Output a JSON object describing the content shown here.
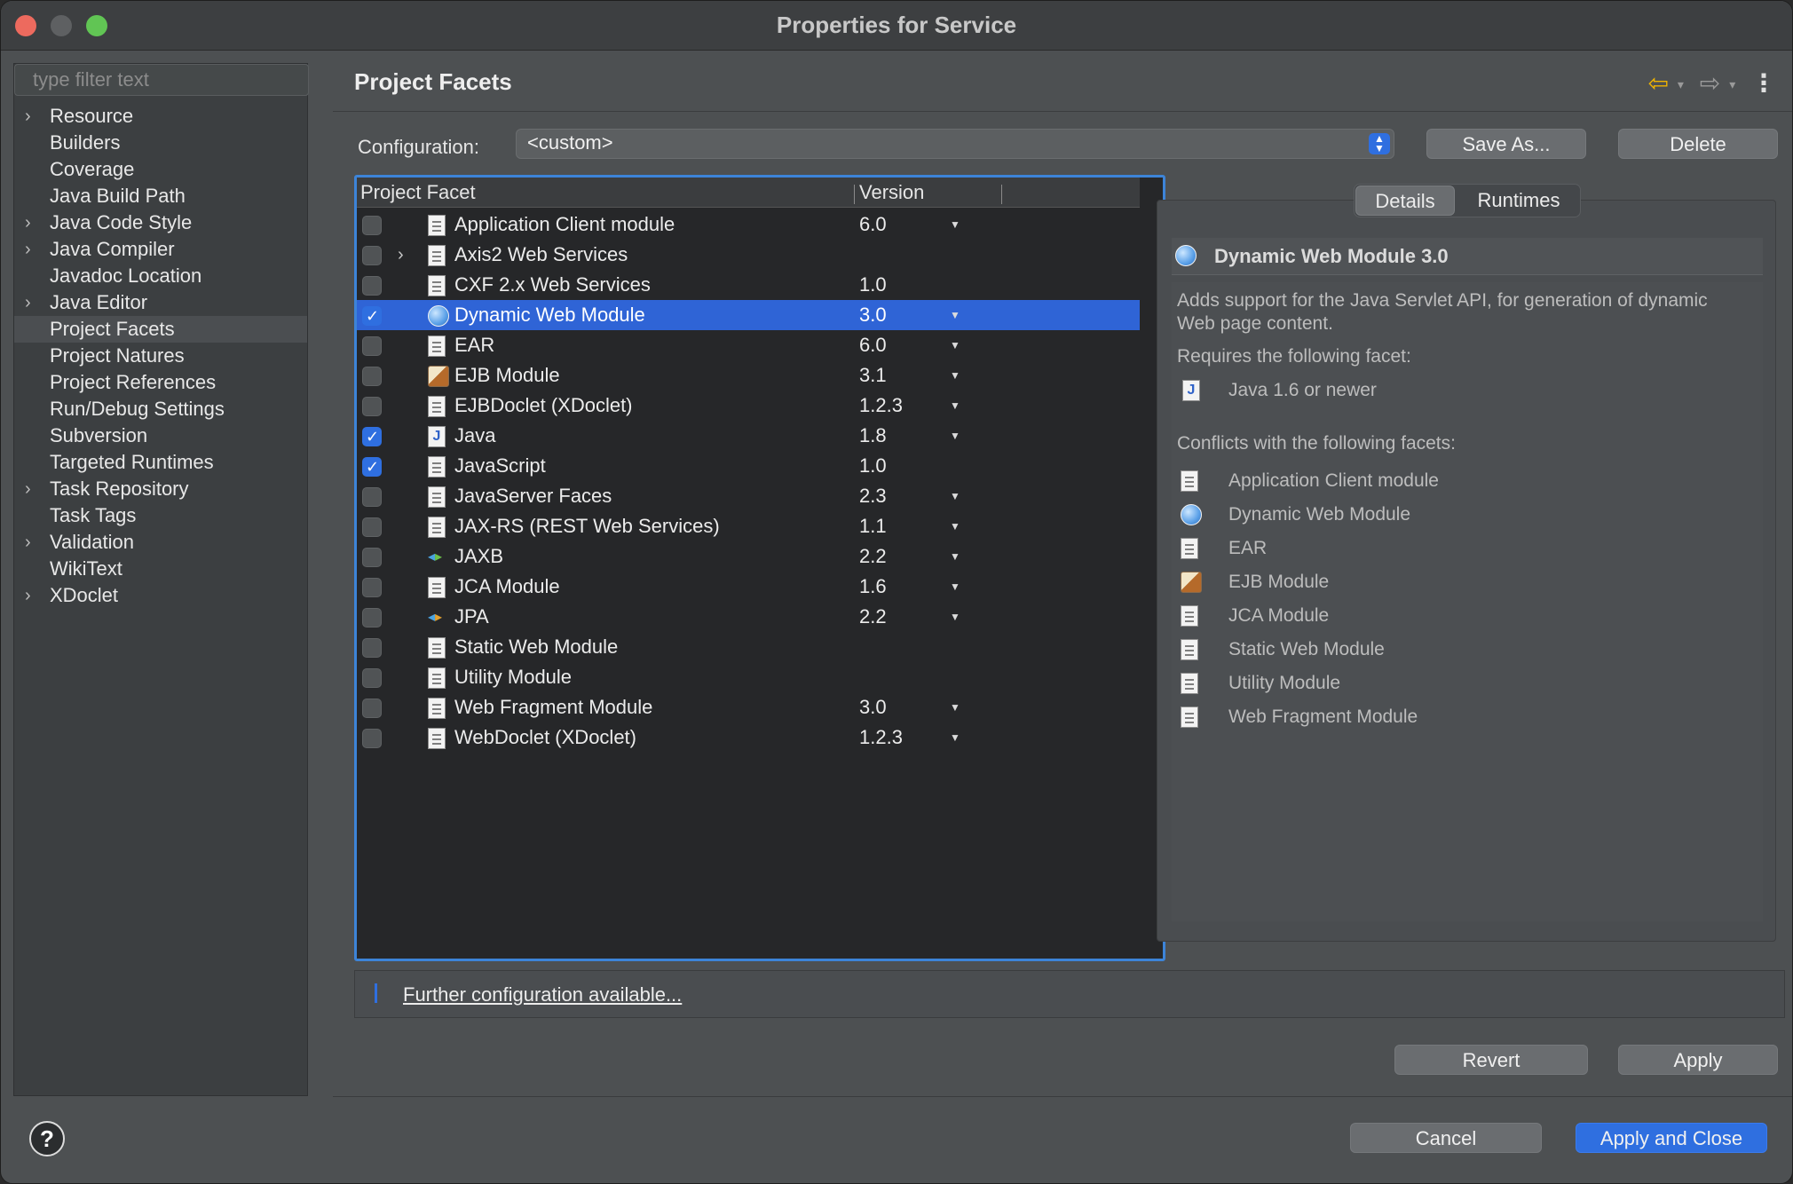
{
  "window": {
    "title": "Properties for Service"
  },
  "sidebar": {
    "filter_placeholder": "type filter text",
    "items": [
      {
        "label": "Resource",
        "expandable": true
      },
      {
        "label": "Builders",
        "expandable": false
      },
      {
        "label": "Coverage",
        "expandable": false
      },
      {
        "label": "Java Build Path",
        "expandable": false
      },
      {
        "label": "Java Code Style",
        "expandable": true
      },
      {
        "label": "Java Compiler",
        "expandable": true
      },
      {
        "label": "Javadoc Location",
        "expandable": false
      },
      {
        "label": "Java Editor",
        "expandable": true
      },
      {
        "label": "Project Facets",
        "expandable": false,
        "selected": true
      },
      {
        "label": "Project Natures",
        "expandable": false
      },
      {
        "label": "Project References",
        "expandable": false
      },
      {
        "label": "Run/Debug Settings",
        "expandable": false
      },
      {
        "label": "Subversion",
        "expandable": false
      },
      {
        "label": "Targeted Runtimes",
        "expandable": false
      },
      {
        "label": "Task Repository",
        "expandable": true
      },
      {
        "label": "Task Tags",
        "expandable": false
      },
      {
        "label": "Validation",
        "expandable": true
      },
      {
        "label": "WikiText",
        "expandable": false
      },
      {
        "label": "XDoclet",
        "expandable": true
      }
    ]
  },
  "main": {
    "title": "Project Facets",
    "configuration": {
      "label": "Configuration:",
      "value": "<custom>",
      "save_as": "Save As...",
      "delete": "Delete"
    },
    "facets_table": {
      "columns": [
        "Project Facet",
        "Version"
      ],
      "rows": [
        {
          "name": "Application Client module",
          "version": "6.0",
          "checked": false,
          "icon": "doc",
          "dropdown": true,
          "expander": false
        },
        {
          "name": "Axis2 Web Services",
          "version": "",
          "checked": false,
          "icon": "doc",
          "dropdown": false,
          "expander": true
        },
        {
          "name": "CXF 2.x Web Services",
          "version": "1.0",
          "checked": false,
          "icon": "doc",
          "dropdown": false,
          "expander": false
        },
        {
          "name": "Dynamic Web Module",
          "version": "3.0",
          "checked": true,
          "icon": "globe",
          "dropdown": true,
          "expander": false,
          "selected": true
        },
        {
          "name": "EAR",
          "version": "6.0",
          "checked": false,
          "icon": "doc",
          "dropdown": true,
          "expander": false
        },
        {
          "name": "EJB Module",
          "version": "3.1",
          "checked": false,
          "icon": "bean",
          "dropdown": true,
          "expander": false
        },
        {
          "name": "EJBDoclet (XDoclet)",
          "version": "1.2.3",
          "checked": false,
          "icon": "doc",
          "dropdown": true,
          "expander": false
        },
        {
          "name": "Java",
          "version": "1.8",
          "checked": true,
          "icon": "java",
          "dropdown": true,
          "expander": false
        },
        {
          "name": "JavaScript",
          "version": "1.0",
          "checked": true,
          "icon": "doc",
          "dropdown": false,
          "expander": false
        },
        {
          "name": "JavaServer Faces",
          "version": "2.3",
          "checked": false,
          "icon": "doc",
          "dropdown": true,
          "expander": false
        },
        {
          "name": "JAX-RS (REST Web Services)",
          "version": "1.1",
          "checked": false,
          "icon": "doc",
          "dropdown": true,
          "expander": false
        },
        {
          "name": "JAXB",
          "version": "2.2",
          "checked": false,
          "icon": "xml-green",
          "dropdown": true,
          "expander": false
        },
        {
          "name": "JCA Module",
          "version": "1.6",
          "checked": false,
          "icon": "doc",
          "dropdown": true,
          "expander": false
        },
        {
          "name": "JPA",
          "version": "2.2",
          "checked": false,
          "icon": "xml-orange",
          "dropdown": true,
          "expander": false
        },
        {
          "name": "Static Web Module",
          "version": "",
          "checked": false,
          "icon": "doc",
          "dropdown": false,
          "expander": false
        },
        {
          "name": "Utility Module",
          "version": "",
          "checked": false,
          "icon": "doc",
          "dropdown": false,
          "expander": false
        },
        {
          "name": "Web Fragment Module",
          "version": "3.0",
          "checked": false,
          "icon": "doc",
          "dropdown": true,
          "expander": false
        },
        {
          "name": "WebDoclet (XDoclet)",
          "version": "1.2.3",
          "checked": false,
          "icon": "doc",
          "dropdown": true,
          "expander": false
        }
      ]
    },
    "details": {
      "tabs": [
        "Details",
        "Runtimes"
      ],
      "active_tab": "Details",
      "title": "Dynamic Web Module 3.0",
      "description": "Adds support for the Java Servlet API, for generation of dynamic Web page content.",
      "requires_label": "Requires the following facet:",
      "requires": [
        {
          "name": "Java 1.6 or newer",
          "icon": "java"
        }
      ],
      "conflicts_label": "Conflicts with the following facets:",
      "conflicts": [
        {
          "name": "Application Client module",
          "icon": "doc"
        },
        {
          "name": "Dynamic Web Module",
          "icon": "globe"
        },
        {
          "name": "EAR",
          "icon": "doc"
        },
        {
          "name": "EJB Module",
          "icon": "bean"
        },
        {
          "name": "JCA Module",
          "icon": "doc"
        },
        {
          "name": "Static Web Module",
          "icon": "doc"
        },
        {
          "name": "Utility Module",
          "icon": "doc"
        },
        {
          "name": "Web Fragment Module",
          "icon": "doc"
        }
      ]
    },
    "further_link": "Further configuration available...",
    "revert": "Revert",
    "apply": "Apply"
  },
  "footer": {
    "help": "?",
    "cancel": "Cancel",
    "apply_close": "Apply and Close"
  }
}
